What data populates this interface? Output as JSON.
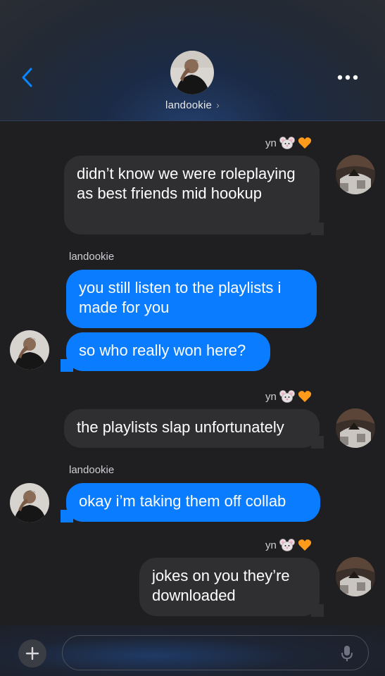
{
  "header": {
    "contact_name": "landookie",
    "chevron": "›",
    "back_icon": "chevron-left-icon",
    "more_icon": "ellipsis-icon"
  },
  "messages": [
    {
      "sender": "yn",
      "emoji": "mouse-face-emoji + orange-heart-emoji",
      "side": "left-gray",
      "text": "didn’t know we were roleplaying as best friends mid hookup"
    },
    {
      "sender": "landookie",
      "side": "right-blue",
      "text": "you still listen to the playlists i made for you"
    },
    {
      "side": "right-blue",
      "text": "so who really won here?"
    },
    {
      "sender": "yn",
      "side": "left-gray",
      "text": "the playlists slap unfortunately"
    },
    {
      "sender": "landookie",
      "side": "right-blue",
      "text": "okay i’m taking them off collab"
    },
    {
      "sender": "yn",
      "side": "left-gray",
      "text": "jokes on you they’re downloaded"
    }
  ],
  "composer": {
    "plus_icon": "plus-icon",
    "mic_icon": "microphone-icon",
    "value": "",
    "placeholder": ""
  },
  "colors": {
    "background": "#1f1f21",
    "gray_bubble": "#2f2f32",
    "blue_bubble": "#0a7cff",
    "accent": "#0a84ff"
  }
}
